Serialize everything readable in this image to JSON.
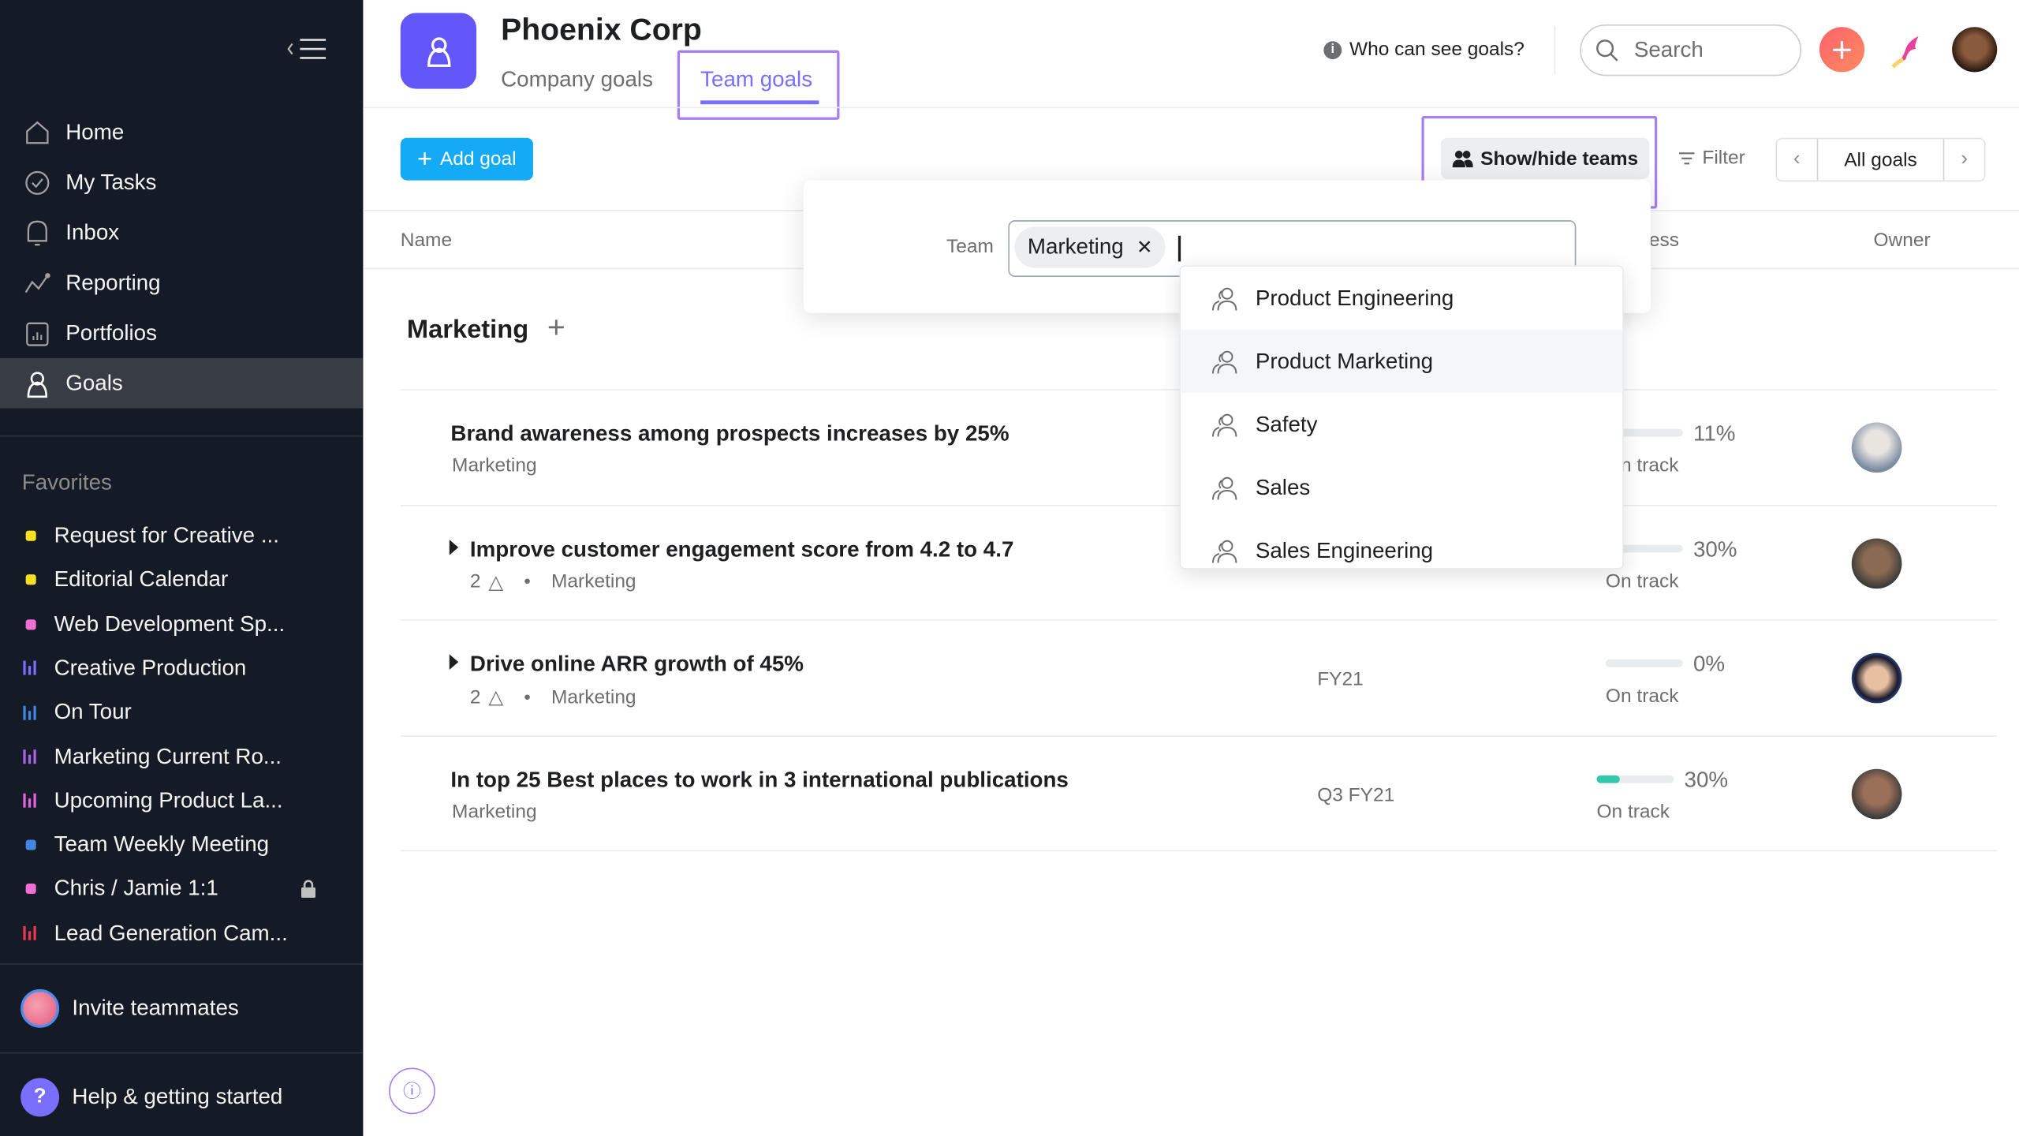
{
  "sidebar": {
    "nav": [
      {
        "label": "Home",
        "icon": "home-icon"
      },
      {
        "label": "My Tasks",
        "icon": "check-circle-icon"
      },
      {
        "label": "Inbox",
        "icon": "bell-icon"
      },
      {
        "label": "Reporting",
        "icon": "line-chart-icon"
      },
      {
        "label": "Portfolios",
        "icon": "portfolio-icon"
      },
      {
        "label": "Goals",
        "icon": "goals-icon",
        "active": true
      }
    ],
    "favorites_title": "Favorites",
    "favorites": [
      {
        "label": "Request for Creative ...",
        "type": "dot",
        "color": "#f8df23"
      },
      {
        "label": "Editorial Calendar",
        "type": "dot",
        "color": "#f8df23"
      },
      {
        "label": "Web Development Sp...",
        "type": "dot",
        "color": "#f06fd6"
      },
      {
        "label": "Creative Production",
        "type": "bars",
        "color": "#796eff"
      },
      {
        "label": "On Tour",
        "type": "bars",
        "color": "#4186e0"
      },
      {
        "label": "Marketing Current Ro...",
        "type": "bars",
        "color": "#aa62e3"
      },
      {
        "label": "Upcoming Product La...",
        "type": "bars",
        "color": "#e362e3"
      },
      {
        "label": "Team Weekly Meeting",
        "type": "dot",
        "color": "#4186e0"
      },
      {
        "label": "Chris / Jamie 1:1",
        "type": "dot",
        "color": "#f06fd6",
        "locked": true
      },
      {
        "label": "Lead Generation Cam...",
        "type": "bars",
        "color": "#e8384f"
      }
    ],
    "invite": "Invite teammates",
    "help": "Help & getting started"
  },
  "header": {
    "title": "Phoenix Corp",
    "tabs": [
      {
        "label": "Company goals"
      },
      {
        "label": "Team goals",
        "active": true
      }
    ],
    "who_can_see": "Who can see goals?",
    "search_placeholder": "Search"
  },
  "toolbar": {
    "add_goal": "Add goal",
    "show_hide_teams": "Show/hide teams",
    "filter": "Filter",
    "view": "All goals"
  },
  "columns": {
    "name": "Name",
    "progress": "Progress",
    "owner": "Owner"
  },
  "group": {
    "title": "Marketing"
  },
  "goals": [
    {
      "title": "Brand awareness among prospects increases by 25%",
      "team": "Marketing",
      "period": "",
      "progress": 11,
      "percent": "11%",
      "status": "On track"
    },
    {
      "title": "Improve customer engagement score from 4.2 to 4.7",
      "subgoals": "2",
      "team": "Marketing",
      "period": "",
      "progress": 3,
      "percent": "30%",
      "status": "On track"
    },
    {
      "title": "Drive online ARR growth of 45%",
      "subgoals": "2",
      "team": "Marketing",
      "period": "FY21",
      "progress": 0,
      "percent": "0%",
      "status": "On track"
    },
    {
      "title": "In top 25 Best places to work in 3 international publications",
      "team": "Marketing",
      "period": "Q3 FY21",
      "progress": 30,
      "percent": "30%",
      "status": "On track"
    }
  ],
  "team_popover": {
    "label": "Team",
    "selected_chip": "Marketing",
    "options": [
      "Product Engineering",
      "Product Marketing",
      "Safety",
      "Sales",
      "Sales Engineering"
    ],
    "highlighted": "Product Marketing"
  },
  "colors": {
    "sidebar": "#151b26",
    "accent": "#796eff",
    "add_button": "#14aaf5",
    "progress": "#37c5ab",
    "highlight_box": "#a67ff0"
  }
}
